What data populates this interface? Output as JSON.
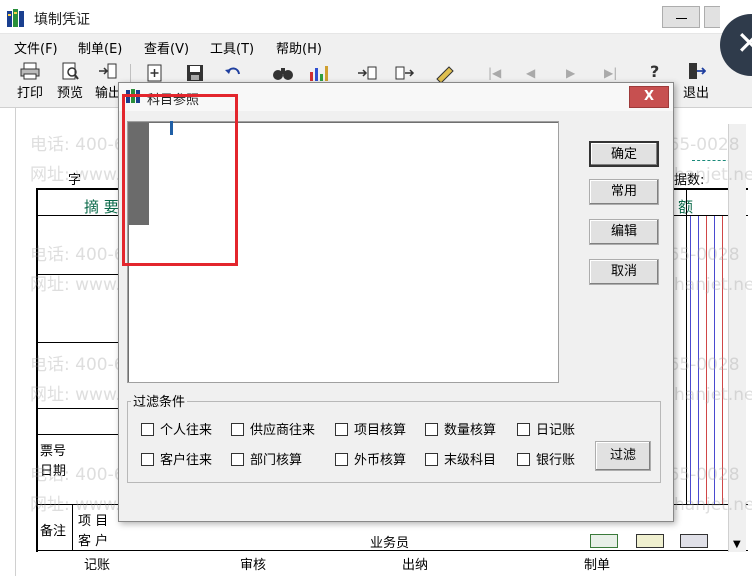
{
  "window": {
    "title": "填制凭证"
  },
  "menu": [
    "文件(F)",
    "制单(E)",
    "查看(V)",
    "工具(T)",
    "帮助(H)"
  ],
  "toolbar": {
    "print": "打印",
    "preview": "预览",
    "output": "输出",
    "exit": "退出"
  },
  "voucher": {
    "zi_label": "字",
    "summary_header": "摘 要",
    "count_label": "据数:",
    "amount_header": "额",
    "ticket_no_label": "票号",
    "date_label": "日期",
    "remark_label": "备注",
    "project_label": "项 目",
    "customer_label": "客 户",
    "salesman_label": "业务员",
    "bookkeeper_label": "记账",
    "review_label": "审核",
    "cashier_label": "出纳",
    "maker_label": "制单"
  },
  "watermark": {
    "phone": "电话: 400-665-0028",
    "site": "网址: www.chanjet.net"
  },
  "dialog": {
    "title": "科目参照",
    "close_label": "X",
    "buttons": {
      "ok": "确定",
      "common": "常用",
      "edit": "编辑",
      "cancel": "取消",
      "filter": "过滤"
    },
    "filter": {
      "legend": "过滤条件",
      "row1": [
        "个人往来",
        "供应商往来",
        "项目核算",
        "数量核算",
        "日记账"
      ],
      "row2": [
        "客户往来",
        "部门核算",
        "外币核算",
        "末级科目",
        "银行账"
      ]
    }
  },
  "colors": {
    "highlight": "#e3262d",
    "close": "#c75050",
    "teal": "#0b6a4a"
  }
}
